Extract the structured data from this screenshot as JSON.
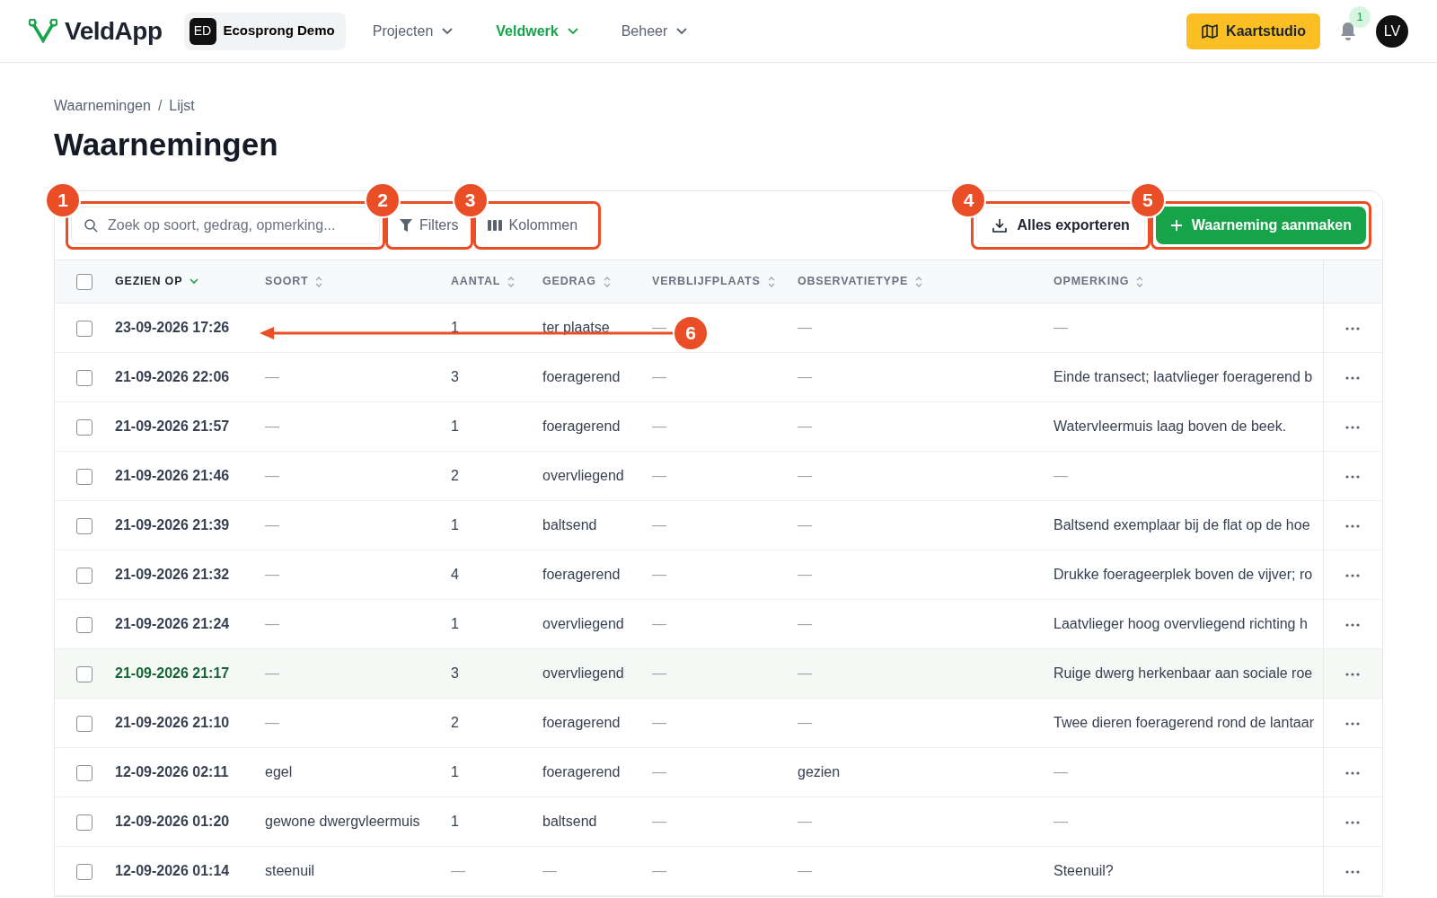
{
  "navbar": {
    "brand": "VeldApp",
    "org": {
      "initials": "ED",
      "name": "Ecosprong Demo"
    },
    "menu": [
      {
        "label": "Projecten",
        "selected": false
      },
      {
        "label": "Veldwerk",
        "selected": true
      },
      {
        "label": "Beheer",
        "selected": false
      }
    ],
    "map_button": "Kaartstudio",
    "notifications": "1",
    "avatar": "LV"
  },
  "breadcrumb": {
    "items": [
      "Waarnemingen",
      "Lijst"
    ],
    "separator": "/"
  },
  "title": "Waarnemingen",
  "toolbar": {
    "search": {
      "placeholder": "Zoek op soort, gedrag, opmerking...",
      "callout": "1"
    },
    "filters": {
      "label": "Filters",
      "callout": "2"
    },
    "columns": {
      "label": "Kolommen",
      "callout": "3"
    },
    "export": {
      "label": "Alles exporteren",
      "callout": "4"
    },
    "create": {
      "label": "Waarneming aanmaken",
      "callout": "5"
    }
  },
  "table": {
    "select_all": {
      "checked": false
    },
    "columns": [
      {
        "label": "GEZIEN OP",
        "sorted": true
      },
      {
        "label": "SOORT",
        "sorted": false
      },
      {
        "label": "AANTAL",
        "sorted": false
      },
      {
        "label": "GEDRAG",
        "sorted": false
      },
      {
        "label": "VERBLIJFPLAATS",
        "sorted": false
      },
      {
        "label": "OBSERVATIETYPE",
        "sorted": false
      },
      {
        "label": "OPMERKING",
        "sorted": false
      }
    ],
    "rows": [
      {
        "checked": false,
        "highlighted": false,
        "cells": [
          "23-09-2026 17:26",
          null,
          "1",
          "ter plaatse",
          "—",
          "—",
          "—"
        ],
        "arrow_callout": "6"
      },
      {
        "checked": false,
        "highlighted": false,
        "cells": [
          "21-09-2026 22:06",
          "—",
          "3",
          "foeragerend",
          "—",
          "—",
          "Einde transect; laatvlieger foeragerend b"
        ]
      },
      {
        "checked": false,
        "highlighted": false,
        "cells": [
          "21-09-2026 21:57",
          "—",
          "1",
          "foeragerend",
          "—",
          "—",
          "Watervleermuis laag boven de beek."
        ]
      },
      {
        "checked": false,
        "highlighted": false,
        "cells": [
          "21-09-2026 21:46",
          "—",
          "2",
          "overvliegend",
          "—",
          "—",
          "—"
        ]
      },
      {
        "checked": false,
        "highlighted": false,
        "cells": [
          "21-09-2026 21:39",
          "—",
          "1",
          "baltsend",
          "—",
          "—",
          "Baltsend exemplaar bij de flat op de hoe"
        ]
      },
      {
        "checked": false,
        "highlighted": false,
        "cells": [
          "21-09-2026 21:32",
          "—",
          "4",
          "foeragerend",
          "—",
          "—",
          "Drukke foerageerplek boven de vijver; ro"
        ]
      },
      {
        "checked": false,
        "highlighted": false,
        "cells": [
          "21-09-2026 21:24",
          "—",
          "1",
          "overvliegend",
          "—",
          "—",
          "Laatvlieger hoog overvliegend richting h"
        ]
      },
      {
        "checked": false,
        "highlighted": true,
        "cells": [
          "21-09-2026 21:17",
          "—",
          "3",
          "overvliegend",
          "—",
          "—",
          "Ruige dwerg herkenbaar aan sociale roe"
        ]
      },
      {
        "checked": false,
        "highlighted": false,
        "cells": [
          "21-09-2026 21:10",
          "—",
          "2",
          "foeragerend",
          "—",
          "—",
          "Twee dieren foeragerend rond de lantaar"
        ]
      },
      {
        "checked": false,
        "highlighted": false,
        "cells": [
          "12-09-2026 02:11",
          "egel",
          "1",
          "foeragerend",
          "—",
          "gezien",
          "—"
        ]
      },
      {
        "checked": false,
        "highlighted": false,
        "cells": [
          "12-09-2026 01:20",
          "gewone dwergvleermuis",
          "1",
          "baltsend",
          "—",
          "—",
          "—"
        ]
      },
      {
        "checked": false,
        "highlighted": false,
        "cells": [
          "12-09-2026 01:14",
          "steenuil",
          "—",
          "—",
          "—",
          "—",
          "Steenuil?"
        ]
      }
    ]
  }
}
